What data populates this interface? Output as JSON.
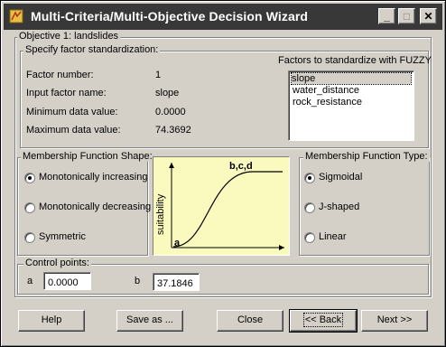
{
  "window": {
    "title": "Multi-Criteria/Multi-Objective Decision Wizard"
  },
  "objective_group": {
    "label": "Objective 1: landslides"
  },
  "standardization_group": {
    "label": "Specify factor standardization:",
    "factor_number_label": "Factor number:",
    "factor_number_value": "1",
    "input_name_label": "Input factor name:",
    "input_name_value": "slope",
    "min_label": "Minimum data value:",
    "min_value": "0.0000",
    "max_label": "Maximum data value:",
    "max_value": "74.3692",
    "list_title": "Factors to standardize with FUZZY",
    "factors": [
      "slope",
      "water_distance",
      "rock_resistance"
    ],
    "selected_factor": "slope"
  },
  "shape_group": {
    "label": "Membership Function Shape:",
    "options": [
      "Monotonically increasing",
      "Monotonically decreasing",
      "Symmetric"
    ],
    "selected": "Monotonically increasing"
  },
  "type_group": {
    "label": "Membership Function Type:",
    "options": [
      "Sigmoidal",
      "J-shaped",
      "Linear"
    ],
    "selected": "Sigmoidal"
  },
  "diagram": {
    "y_label": "suitability",
    "start_label": "a",
    "end_label": "b,c,d"
  },
  "control_points": {
    "label": "Control points:",
    "a_label": "a",
    "a_value": "0.0000",
    "b_label": "b",
    "b_value": "37.1846"
  },
  "buttons": {
    "help": "Help",
    "save_as": "Save as ...",
    "close": "Close",
    "back": "<< Back",
    "next": "Next >>"
  }
}
